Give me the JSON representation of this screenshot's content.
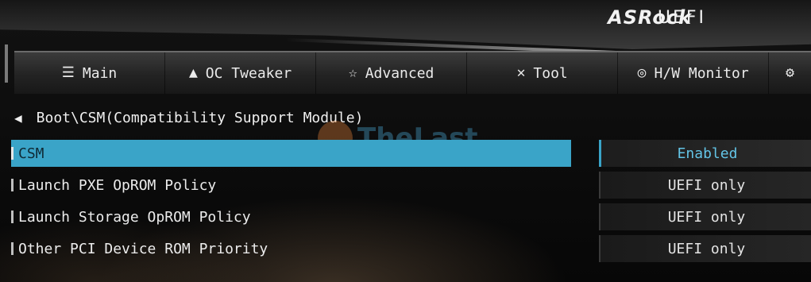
{
  "brand": {
    "name": "ASRock",
    "product": "UEFI"
  },
  "nav": {
    "tabs": [
      {
        "label": "Main",
        "icon": "list-icon"
      },
      {
        "label": "OC Tweaker",
        "icon": "rocket-icon"
      },
      {
        "label": "Advanced",
        "icon": "star-icon"
      },
      {
        "label": "Tool",
        "icon": "tools-icon"
      },
      {
        "label": "H/W Monitor",
        "icon": "monitor-icon"
      },
      {
        "label": "",
        "icon": "security-icon"
      }
    ]
  },
  "breadcrumb": {
    "path": "Boot\\CSM(Compatibility Support Module)"
  },
  "settings": [
    {
      "label": "CSM",
      "value": "Enabled",
      "selected": true
    },
    {
      "label": "Launch PXE OpROM Policy",
      "value": "UEFI only"
    },
    {
      "label": "Launch Storage OpROM Policy",
      "value": "UEFI only"
    },
    {
      "label": "Other PCI Device ROM Priority",
      "value": "UEFI only"
    }
  ],
  "watermark": {
    "text": "TheLast"
  },
  "colors": {
    "highlight": "#3aa4c8",
    "selected_value": "#63c4e6",
    "watermark_text": "#4fb6e8",
    "watermark_drop": "#f28a3c"
  }
}
